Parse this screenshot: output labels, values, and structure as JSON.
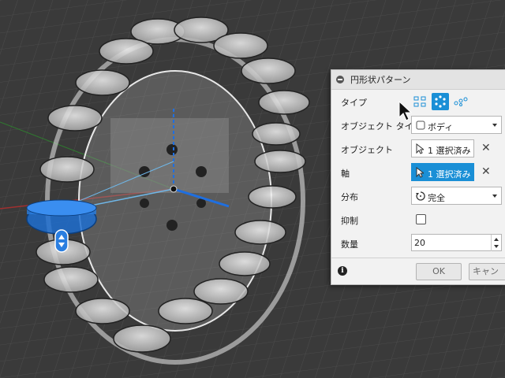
{
  "dialog": {
    "title": "円形状パターン",
    "type_label": "タイプ",
    "type_buttons": [
      "feature-pattern",
      "body-pattern",
      "face-pattern"
    ],
    "object_type_label": "オブジェクト タイプ",
    "object_type_value": "ボディ",
    "objects_label": "オブジェクト",
    "objects_value": "1 選択済み",
    "axis_label": "軸",
    "axis_value": "1 選択済み",
    "distribution_label": "分布",
    "distribution_value": "完全",
    "suppress_label": "抑制",
    "quantity_label": "数量",
    "quantity_value": "20",
    "ok_label": "OK",
    "cancel_label": "キャンセ"
  },
  "colors": {
    "accent": "#1a8fd6",
    "viewport_bg": "#3a3a3a"
  }
}
